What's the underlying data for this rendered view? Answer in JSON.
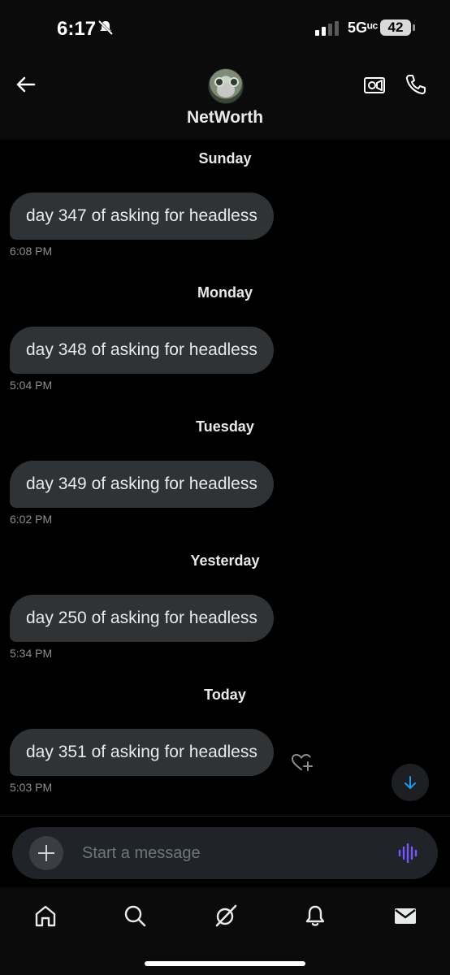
{
  "status_bar": {
    "time": "6:17",
    "network": "5Gᵘᶜ",
    "battery": "42"
  },
  "header": {
    "contact_name": "NetWorth"
  },
  "messages": [
    {
      "day": "Sunday",
      "text": "day 347 of asking for headless",
      "time": "6:08 PM"
    },
    {
      "day": "Monday",
      "text": "day 348 of asking for headless",
      "time": "5:04 PM"
    },
    {
      "day": "Tuesday",
      "text": "day 349 of asking for headless",
      "time": "6:02 PM"
    },
    {
      "day": "Yesterday",
      "text": "day 250 of asking for headless",
      "time": "5:34 PM"
    },
    {
      "day": "Today",
      "text": "day 351 of asking for headless",
      "time": "5:03 PM"
    }
  ],
  "composer": {
    "placeholder": "Start a message"
  },
  "colors": {
    "accent": "#1d9bf0",
    "voice": "#7856ff",
    "bubble": "#2f3336",
    "background": "#000000"
  },
  "icons": [
    "back-arrow-icon",
    "video-call-icon",
    "phone-icon",
    "heart-plus-icon",
    "scroll-down-icon",
    "plus-icon",
    "voice-wave-icon",
    "home-icon",
    "search-icon",
    "grok-icon",
    "bell-icon",
    "mail-icon"
  ]
}
